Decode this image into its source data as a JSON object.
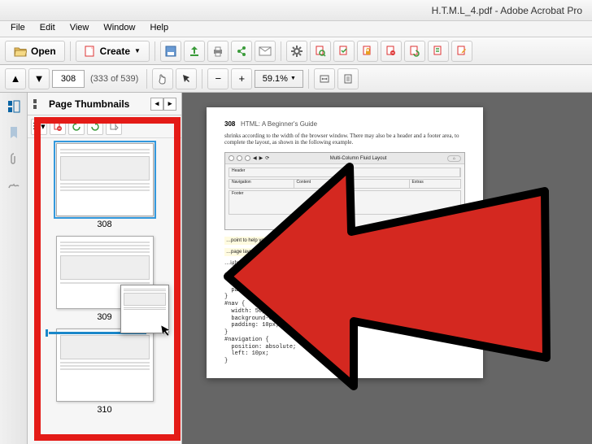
{
  "title": "H.T.M.L_4.pdf - Adobe Acrobat Pro",
  "menubar": [
    "File",
    "Edit",
    "View",
    "Window",
    "Help"
  ],
  "toolbar1": {
    "open_label": "Open",
    "create_label": "Create"
  },
  "toolbar2": {
    "page_current": "308",
    "page_total": "(333 of 539)",
    "zoom": "59.1%"
  },
  "thumbpanel": {
    "title": "Page Thumbnails",
    "pages": [
      "308",
      "309",
      "310"
    ]
  },
  "document": {
    "page_no": "308",
    "chapter": "HTML: A Beginner's Guide",
    "para1": "shrinks according to the width of the browser window. There may also be a header and a footer area, to complete the layout, as shown in the following example.",
    "browser_title": "Multi-Column Fluid Layout",
    "table_headers": [
      "Header",
      "",
      ""
    ],
    "table_row": [
      "Navigation",
      "Content",
      "Extras"
    ],
    "table_footer": "Footer",
    "hint1": "…point to help you build the basic page …ylesheet somewhat, depending on the length",
    "hint2": "…page layout, the following shows what the style s…",
    "caption": "…ight look like:",
    "code": "#header {\n  margin: 10px 10px 0px 10px;\n  padding: 6px;\n}\n#nav {\n  width: 50px;\n  background-color: #999;\n  padding: 10px;\n}\n#navigation {\n  position: absolute;\n  left: 10px;\n}"
  }
}
